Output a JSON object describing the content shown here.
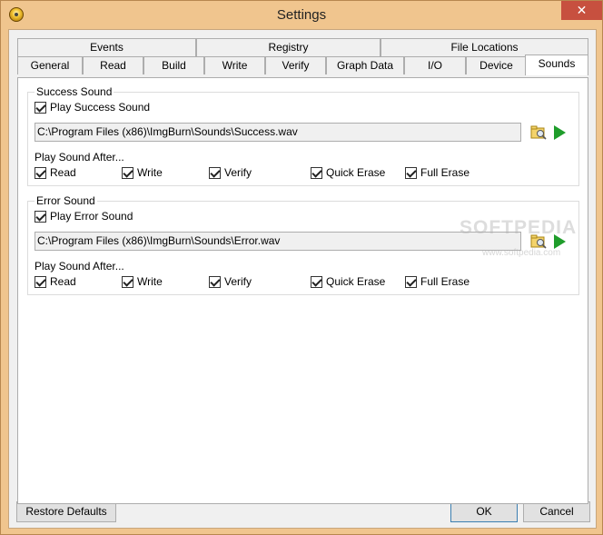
{
  "window": {
    "title": "Settings",
    "close_symbol": "✕"
  },
  "tabs_row1": [
    "Events",
    "Registry",
    "File Locations"
  ],
  "tabs_row2": [
    "General",
    "Read",
    "Build",
    "Write",
    "Verify",
    "Graph Data",
    "I/O",
    "Device",
    "Sounds"
  ],
  "success": {
    "group_label": "Success Sound",
    "play_label": "Play Success Sound",
    "path": "C:\\Program Files (x86)\\ImgBurn\\Sounds\\Success.wav",
    "after_label": "Play Sound After...",
    "options": [
      "Read",
      "Write",
      "Verify",
      "Quick Erase",
      "Full Erase"
    ]
  },
  "error": {
    "group_label": "Error Sound",
    "play_label": "Play Error Sound",
    "path": "C:\\Program Files (x86)\\ImgBurn\\Sounds\\Error.wav",
    "after_label": "Play Sound After...",
    "options": [
      "Read",
      "Write",
      "Verify",
      "Quick Erase",
      "Full Erase"
    ]
  },
  "buttons": {
    "restore": "Restore Defaults",
    "ok": "OK",
    "cancel": "Cancel"
  },
  "watermark": {
    "main": "SOFTPEDIA",
    "sub": "www.softpedia.com"
  },
  "colors": {
    "titlebar": "#f0c58e",
    "close": "#c7503f",
    "play": "#1f9d2b"
  }
}
